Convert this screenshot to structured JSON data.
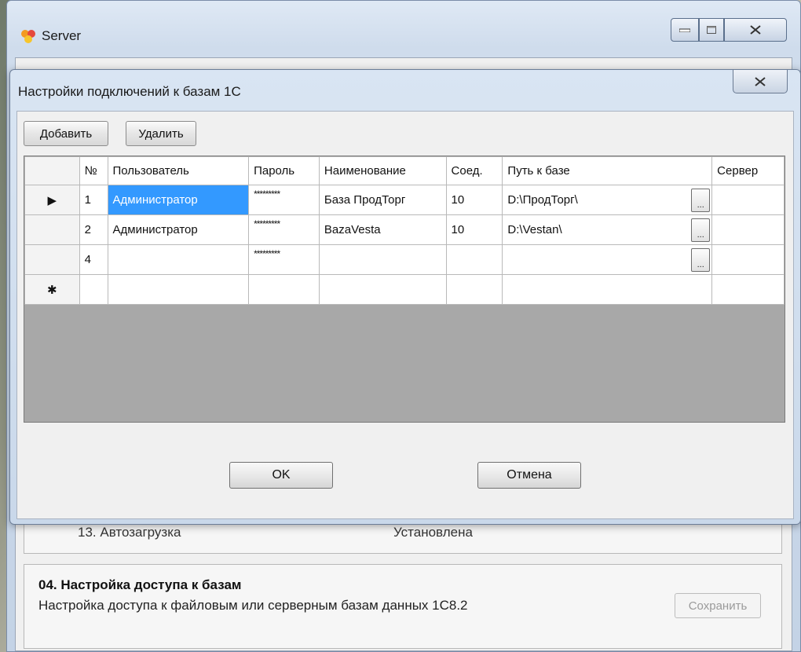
{
  "server_window": {
    "title": "Server"
  },
  "background": {
    "row3": {
      "name": "13. Автозагрузка",
      "status": "Установлена"
    },
    "row4": {
      "title": "04. Настройка доступа к базам",
      "description": "Настройка доступа к файловым или серверным базам данных 1С8.2",
      "save_label": "Сохранить"
    }
  },
  "dialog": {
    "title": "Настройки подключений к базам 1С",
    "toolbar": {
      "add_label": "Добавить",
      "delete_label": "Удалить"
    },
    "grid": {
      "columns": [
        "№",
        "Пользователь",
        "Пароль",
        "Наименование",
        "Соед.",
        "Путь к базе",
        "Сервер"
      ],
      "rows": [
        {
          "marker": "▶",
          "num": "1",
          "user": "Администратор",
          "password": "*********",
          "name": "База ПродТорг",
          "conn": "10",
          "path": "D:\\ПродТорг\\",
          "server": ""
        },
        {
          "marker": "",
          "num": "2",
          "user": "Администратор",
          "password": "*********",
          "name": "BazaVesta",
          "conn": "10",
          "path": "D:\\Vestan\\",
          "server": ""
        },
        {
          "marker": "",
          "num": "4",
          "user": "",
          "password": "*********",
          "name": "",
          "conn": "",
          "path": "",
          "server": ""
        }
      ],
      "new_row_marker": "✱",
      "ellipsis_label": "..."
    },
    "ok_label": "OK",
    "cancel_label": "Отмена"
  },
  "colors": {
    "selection": "#3399ff",
    "grid_empty_area": "#a8a8a8"
  }
}
